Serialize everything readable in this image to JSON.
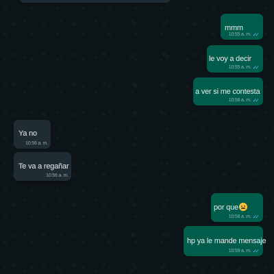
{
  "chat": {
    "messages": [
      {
        "direction": "outgoing",
        "text": "mmm",
        "time": "10:55 a. m.",
        "status": "read"
      },
      {
        "direction": "outgoing",
        "text": "le voy a decir",
        "time": "10:55 a. m.",
        "status": "read"
      },
      {
        "direction": "outgoing",
        "text": "a ver si me contesta",
        "time": "10:56 a. m.",
        "status": "read"
      },
      {
        "direction": "incoming",
        "text": "Ya no",
        "time": "10:56 a. m."
      },
      {
        "direction": "incoming",
        "text": "Te va a regañar",
        "time": "10:56 a. m."
      },
      {
        "direction": "outgoing",
        "text": "por que",
        "emoji": "grimacing-face",
        "time": "10:58 a. m.",
        "status": "read"
      },
      {
        "direction": "outgoing",
        "text": "hp ya le mande mensaje",
        "time": "10:59 a. m.",
        "status": "read"
      }
    ]
  },
  "colors": {
    "outgoing_bubble": "#005c4b",
    "incoming_bubble": "#1f2c34",
    "read_ticks": "#53bdeb",
    "background": "#0b141a"
  },
  "icons": {
    "read_status": "✓✓"
  }
}
